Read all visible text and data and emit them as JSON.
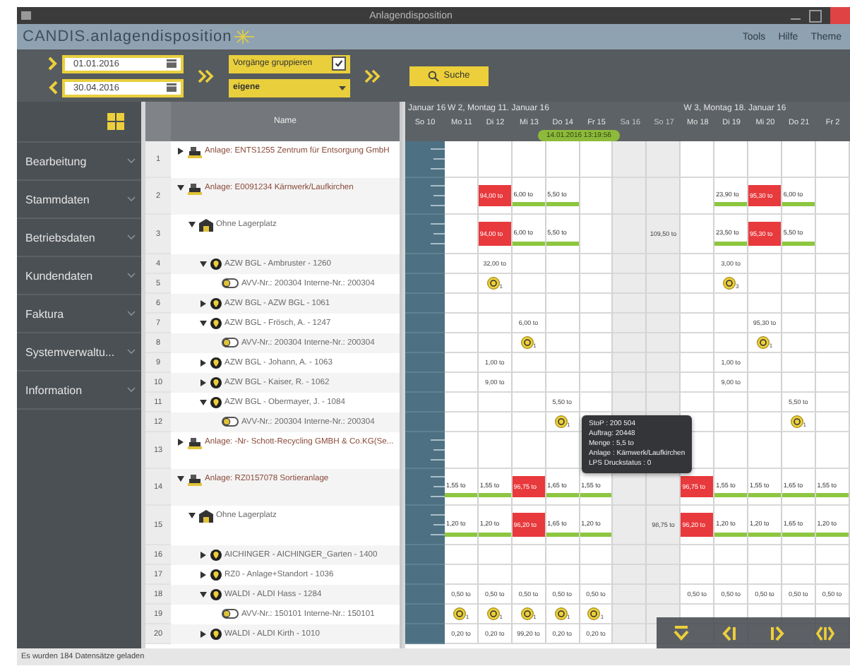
{
  "window": {
    "title": "Anlagendisposition"
  },
  "brand": {
    "name": "CANDIS",
    "product": ".anlagendisposition"
  },
  "menu": [
    "Tools",
    "Hilfe",
    "Theme"
  ],
  "toolbar": {
    "date_from": "01.01.2016",
    "date_to": "30.04.2016",
    "group_label": "Vorgänge gruppieren",
    "group_checked": true,
    "grouping": "eigene",
    "search_button": "Suche"
  },
  "sidebar": {
    "items": [
      "Bearbeitung",
      "Stammdaten",
      "Betriebsdaten",
      "Kundendaten",
      "Faktura",
      "Systemverwaltu...",
      "Information"
    ]
  },
  "tree": {
    "column": "Name",
    "rows": [
      {
        "number": "1",
        "kind": "site",
        "label": "Anlage: ENTS1255 Zentrum für Entsorgung GmbH",
        "expanded": false
      },
      {
        "number": "2",
        "kind": "site",
        "label": "Anlage: E0091234 Kärnwerk/Laufkirchen",
        "expanded": true,
        "cells": [
          {
            "kind": "none"
          },
          {
            "kind": "over",
            "label": "94,00 to"
          },
          {
            "kind": "load",
            "label": "6,00 to"
          },
          {
            "kind": "load",
            "label": "5,50 to"
          },
          {
            "kind": "none"
          },
          {
            "kind": "none"
          },
          {
            "kind": "none"
          },
          {
            "kind": "none"
          },
          {
            "kind": "load",
            "label": "23,90 to"
          },
          {
            "kind": "over",
            "label": "95,30 to"
          },
          {
            "kind": "load",
            "label": "6,00 to"
          },
          {
            "kind": "none"
          }
        ],
        "children": [
          {
            "number": "3",
            "kind": "place",
            "label": "Ohne Lagerplatz",
            "expanded": true,
            "cells": [
              {
                "kind": "none"
              },
              {
                "kind": "over",
                "label": "94,00 to"
              },
              {
                "kind": "load",
                "label": "6,00 to"
              },
              {
                "kind": "load",
                "label": "5,50 to"
              },
              {
                "kind": "none"
              },
              {
                "kind": "none"
              },
              {
                "kind": "value",
                "label": "109,50 to"
              },
              {
                "kind": "none"
              },
              {
                "kind": "load",
                "label": "23,50 to"
              },
              {
                "kind": "over",
                "label": "95,30 to"
              },
              {
                "kind": "load",
                "label": "5,50 to"
              },
              {
                "kind": "none"
              }
            ],
            "children": [
              {
                "number": "4",
                "kind": "customer",
                "label": "AZW BGL - Ambruster - 1260",
                "expanded": true,
                "cells": [
                  {
                    "kind": "none"
                  },
                  {
                    "kind": "value",
                    "label": "32,00 to"
                  },
                  {
                    "kind": "none"
                  },
                  {
                    "kind": "none"
                  },
                  {
                    "kind": "none"
                  },
                  {
                    "kind": "none"
                  },
                  {
                    "kind": "none"
                  },
                  {
                    "kind": "none"
                  },
                  {
                    "kind": "value",
                    "label": "3,00 to"
                  },
                  {
                    "kind": "none"
                  },
                  {
                    "kind": "none"
                  },
                  {
                    "kind": "none"
                  }
                ],
                "children": [
                  {
                    "number": "5",
                    "kind": "order",
                    "label": "AVV-Nr.: 200304  Interne-Nr.: 200304",
                    "cells": [
                      {
                        "kind": "none"
                      },
                      {
                        "kind": "coin",
                        "count": "1"
                      },
                      {
                        "kind": "none"
                      },
                      {
                        "kind": "none"
                      },
                      {
                        "kind": "none"
                      },
                      {
                        "kind": "none"
                      },
                      {
                        "kind": "none"
                      },
                      {
                        "kind": "none"
                      },
                      {
                        "kind": "coin",
                        "count": "3"
                      },
                      {
                        "kind": "none"
                      },
                      {
                        "kind": "none"
                      },
                      {
                        "kind": "none"
                      }
                    ]
                  }
                ]
              },
              {
                "number": "6",
                "kind": "customer",
                "label": "AZW BGL - AZW BGL - 1061",
                "expanded": false
              },
              {
                "number": "7",
                "kind": "customer",
                "label": "AZW BGL - Frösch, A. - 1247",
                "expanded": true,
                "cells": [
                  {
                    "kind": "none"
                  },
                  {
                    "kind": "none"
                  },
                  {
                    "kind": "value",
                    "label": "6,00 to"
                  },
                  {
                    "kind": "none"
                  },
                  {
                    "kind": "none"
                  },
                  {
                    "kind": "none"
                  },
                  {
                    "kind": "none"
                  },
                  {
                    "kind": "none"
                  },
                  {
                    "kind": "none"
                  },
                  {
                    "kind": "value",
                    "label": "95,30 to"
                  },
                  {
                    "kind": "none"
                  },
                  {
                    "kind": "none"
                  }
                ],
                "children": [
                  {
                    "number": "8",
                    "kind": "order",
                    "label": "AVV-Nr.: 200304  Interne-Nr.: 200304",
                    "cells": [
                      {
                        "kind": "none"
                      },
                      {
                        "kind": "none"
                      },
                      {
                        "kind": "coin",
                        "count": "1"
                      },
                      {
                        "kind": "none"
                      },
                      {
                        "kind": "none"
                      },
                      {
                        "kind": "none"
                      },
                      {
                        "kind": "none"
                      },
                      {
                        "kind": "none"
                      },
                      {
                        "kind": "none"
                      },
                      {
                        "kind": "coin",
                        "count": "1"
                      },
                      {
                        "kind": "none"
                      },
                      {
                        "kind": "none"
                      }
                    ]
                  }
                ]
              },
              {
                "number": "9",
                "kind": "customer",
                "label": "AZW BGL - Johann, A. - 1063",
                "expanded": false,
                "cells": [
                  {
                    "kind": "none"
                  },
                  {
                    "kind": "value",
                    "label": "1,00 to"
                  },
                  {
                    "kind": "none"
                  },
                  {
                    "kind": "none"
                  },
                  {
                    "kind": "none"
                  },
                  {
                    "kind": "none"
                  },
                  {
                    "kind": "none"
                  },
                  {
                    "kind": "none"
                  },
                  {
                    "kind": "value",
                    "label": "1,00 to"
                  },
                  {
                    "kind": "none"
                  },
                  {
                    "kind": "none"
                  },
                  {
                    "kind": "none"
                  }
                ]
              },
              {
                "number": "10",
                "kind": "customer",
                "label": "AZW BGL - Kaiser, R. - 1062",
                "expanded": false,
                "cells": [
                  {
                    "kind": "none"
                  },
                  {
                    "kind": "value",
                    "label": "9,00 to"
                  },
                  {
                    "kind": "none"
                  },
                  {
                    "kind": "none"
                  },
                  {
                    "kind": "none"
                  },
                  {
                    "kind": "none"
                  },
                  {
                    "kind": "none"
                  },
                  {
                    "kind": "none"
                  },
                  {
                    "kind": "value",
                    "label": "9,00 to"
                  },
                  {
                    "kind": "none"
                  },
                  {
                    "kind": "none"
                  },
                  {
                    "kind": "none"
                  }
                ]
              },
              {
                "number": "11",
                "kind": "customer",
                "label": "AZW BGL - Obermayer, J. - 1084",
                "expanded": true,
                "cells": [
                  {
                    "kind": "none"
                  },
                  {
                    "kind": "none"
                  },
                  {
                    "kind": "none"
                  },
                  {
                    "kind": "value",
                    "label": "5,50 to"
                  },
                  {
                    "kind": "none"
                  },
                  {
                    "kind": "none"
                  },
                  {
                    "kind": "none"
                  },
                  {
                    "kind": "none"
                  },
                  {
                    "kind": "none"
                  },
                  {
                    "kind": "none"
                  },
                  {
                    "kind": "value",
                    "label": "5,50 to"
                  },
                  {
                    "kind": "none"
                  }
                ],
                "children": [
                  {
                    "number": "12",
                    "kind": "order",
                    "label": "AVV-Nr.: 200304  Interne-Nr.: 200304",
                    "cells": [
                      {
                        "kind": "none"
                      },
                      {
                        "kind": "none"
                      },
                      {
                        "kind": "none"
                      },
                      {
                        "kind": "coin",
                        "count": "1"
                      },
                      {
                        "kind": "none"
                      },
                      {
                        "kind": "none"
                      },
                      {
                        "kind": "none"
                      },
                      {
                        "kind": "none"
                      },
                      {
                        "kind": "none"
                      },
                      {
                        "kind": "none"
                      },
                      {
                        "kind": "coin",
                        "count": "1"
                      },
                      {
                        "kind": "none"
                      }
                    ]
                  }
                ]
              }
            ]
          }
        ]
      },
      {
        "number": "13",
        "kind": "site",
        "label": "Anlage: -Nr- Schott-Recycling GMBH & Co.KG(Se...",
        "expanded": false
      },
      {
        "number": "14",
        "kind": "site",
        "label": "Anlage: RZ0157078 Sortieranlage",
        "expanded": true,
        "cells": [
          {
            "kind": "load",
            "label": "1,55 to"
          },
          {
            "kind": "load",
            "label": "1,55 to"
          },
          {
            "kind": "over",
            "label": "96,75 to"
          },
          {
            "kind": "load",
            "label": "1,65 to"
          },
          {
            "kind": "load",
            "label": "1,55 to"
          },
          {
            "kind": "none"
          },
          {
            "kind": "none"
          },
          {
            "kind": "over",
            "label": "96,75 to"
          },
          {
            "kind": "load",
            "label": "1,55 to"
          },
          {
            "kind": "load",
            "label": "1,55 to"
          },
          {
            "kind": "load",
            "label": "1,65 to"
          },
          {
            "kind": "load",
            "label": "1,55 to"
          }
        ],
        "children": [
          {
            "number": "15",
            "kind": "place",
            "label": "Ohne Lagerplatz",
            "expanded": true,
            "cells": [
              {
                "kind": "load",
                "label": "1,20 to"
              },
              {
                "kind": "load",
                "label": "1,20 to"
              },
              {
                "kind": "over",
                "label": "96,20 to"
              },
              {
                "kind": "load",
                "label": "1,65 to"
              },
              {
                "kind": "load",
                "label": "1,20 to"
              },
              {
                "kind": "none"
              },
              {
                "kind": "value",
                "label": "98,75 to"
              },
              {
                "kind": "over",
                "label": "96,20 to"
              },
              {
                "kind": "load",
                "label": "1,20 to"
              },
              {
                "kind": "load",
                "label": "1,20 to"
              },
              {
                "kind": "load",
                "label": "1,65 to"
              },
              {
                "kind": "load",
                "label": "1,20 to"
              }
            ],
            "children": [
              {
                "number": "16",
                "kind": "customer",
                "label": "AICHINGER - AICHINGER_Garten - 1400",
                "expanded": false
              },
              {
                "number": "17",
                "kind": "customer",
                "label": "RZ0 - Anlage+Standort - 1036",
                "expanded": false
              },
              {
                "number": "18",
                "kind": "customer",
                "label": "WALDI - ALDI Hass - 1284",
                "expanded": true,
                "cells": [
                  {
                    "kind": "value",
                    "label": "0,50 to"
                  },
                  {
                    "kind": "value",
                    "label": "0,50 to"
                  },
                  {
                    "kind": "value",
                    "label": "0,50 to"
                  },
                  {
                    "kind": "value",
                    "label": "0,50 to"
                  },
                  {
                    "kind": "value",
                    "label": "0,50 to"
                  },
                  {
                    "kind": "none"
                  },
                  {
                    "kind": "none"
                  },
                  {
                    "kind": "value",
                    "label": "0,50 to"
                  },
                  {
                    "kind": "value",
                    "label": "0,50 to"
                  },
                  {
                    "kind": "value",
                    "label": "0,50 to"
                  },
                  {
                    "kind": "value",
                    "label": "0,50 to"
                  },
                  {
                    "kind": "value",
                    "label": "0,50 to"
                  }
                ],
                "children": [
                  {
                    "number": "19",
                    "kind": "order",
                    "label": "AVV-Nr.: 150101  Interne-Nr.: 150101",
                    "cells": [
                      {
                        "kind": "coin",
                        "count": "1"
                      },
                      {
                        "kind": "coin",
                        "count": "1"
                      },
                      {
                        "kind": "coin",
                        "count": "1"
                      },
                      {
                        "kind": "coin",
                        "count": "1"
                      },
                      {
                        "kind": "coin",
                        "count": "1"
                      },
                      {
                        "kind": "none"
                      },
                      {
                        "kind": "none"
                      },
                      {
                        "kind": "none"
                      },
                      {
                        "kind": "none"
                      },
                      {
                        "kind": "none"
                      },
                      {
                        "kind": "none"
                      },
                      {
                        "kind": "none"
                      }
                    ]
                  }
                ]
              },
              {
                "number": "20",
                "kind": "customer",
                "label": "WALDI - ALDI Kirth - 1010",
                "expanded": false,
                "cells": [
                  {
                    "kind": "value",
                    "label": "0,20 to"
                  },
                  {
                    "kind": "value",
                    "label": "0,20 to"
                  },
                  {
                    "kind": "value",
                    "label": "99,20 to"
                  },
                  {
                    "kind": "value",
                    "label": "0,20 to"
                  },
                  {
                    "kind": "value",
                    "label": "0,20 to"
                  },
                  {
                    "kind": "none"
                  },
                  {
                    "kind": "none"
                  },
                  {
                    "kind": "none"
                  },
                  {
                    "kind": "none"
                  },
                  {
                    "kind": "none"
                  },
                  {
                    "kind": "none"
                  },
                  {
                    "kind": "none"
                  }
                ]
              }
            ]
          }
        ]
      }
    ]
  },
  "gantt": {
    "axis_week": "Januar 16",
    "weeks": [
      "W 2, Montag 11. Januar 16",
      "W 3, Montag 18. Januar 16"
    ],
    "axis_day": "So 10",
    "days": [
      {
        "label": "Mo 11",
        "weekend": false
      },
      {
        "label": "Di 12",
        "weekend": false
      },
      {
        "label": "Mi 13",
        "weekend": false
      },
      {
        "label": "Do 14",
        "weekend": false
      },
      {
        "label": "Fr 15",
        "weekend": false
      },
      {
        "label": "Sa 16",
        "weekend": true
      },
      {
        "label": "So 17",
        "weekend": true
      },
      {
        "label": "Mo 18",
        "weekend": false
      },
      {
        "label": "Di 19",
        "weekend": false
      },
      {
        "label": "Mi 20",
        "weekend": false
      },
      {
        "label": "Do 21",
        "weekend": false
      },
      {
        "label": "Fr 2",
        "weekend": false
      }
    ],
    "today": "14.01.2016 13:19:56"
  },
  "tooltip": {
    "lines": [
      "StoP : 200 504",
      "Auftrag: 20448",
      "Menge : 5,5 to",
      "Anlage : Kärnwerk/Laufkirchen",
      "LPS Druckstatus : 0"
    ]
  },
  "status_bar": "Es wurden 184 Datensätze geladen"
}
